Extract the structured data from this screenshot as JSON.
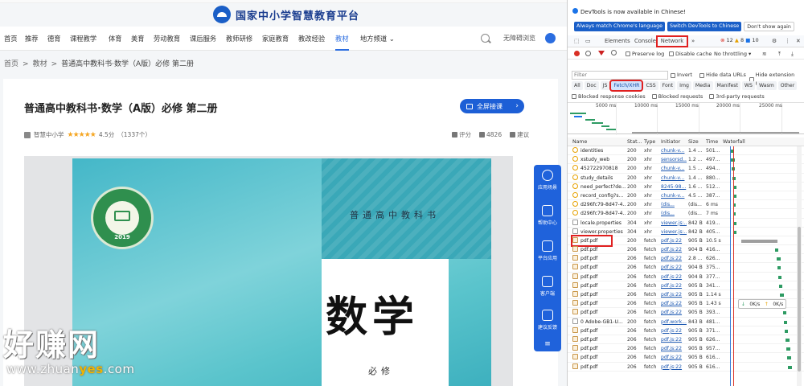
{
  "site": {
    "title": "国家中小学智慧教育平台"
  },
  "nav": {
    "items": [
      "首页",
      "推荐",
      "德育",
      "课程教学",
      "体育",
      "美育",
      "劳动教育",
      "课后服务",
      "教师研修",
      "家庭教育",
      "教改经验",
      "教材",
      "地方频道"
    ],
    "active": "教材",
    "accessibility": "无障碍浏览",
    "dropdown_glyph": "⌄"
  },
  "breadcrumb": {
    "items": [
      "首页",
      "教材",
      "普通高中教科书·数学（A版）必修 第二册"
    ],
    "sep": ">"
  },
  "book": {
    "title": "普通高中教科书·数学（A版）必修 第二册",
    "download_label": "全屏接课",
    "publisher": "智慧中小学",
    "stars": "★★★★★",
    "rating": "4.5分",
    "rating_count": "（1337个）",
    "actions": {
      "rate": "评分",
      "likes": "4826",
      "suggest": "建议"
    },
    "cover": {
      "series": "普通高中教科书",
      "subject": "数学",
      "volume": "必修",
      "seal_year": "2019"
    }
  },
  "side_panel": {
    "items": [
      "应用场景",
      "帮助中心",
      "平台应用",
      "客户端",
      "建议反馈"
    ]
  },
  "watermark": {
    "main": "好赚网",
    "url_a": "www.zhuan",
    "url_b": "yes",
    "url_c": ".com"
  },
  "devtools": {
    "notice": "DevTools is now available in Chinese!",
    "btn_match": "Always match Chrome's language",
    "btn_switch": "Switch DevTools to Chinese",
    "btn_dismiss": "Don't show again",
    "tabs": [
      "Elements",
      "Console",
      "Network"
    ],
    "active_tab": "Network",
    "more": "»",
    "errors": "12",
    "warnings": "8",
    "infos": "10",
    "toolbar": {
      "preserve_log": "Preserve log",
      "disable_cache": "Disable cache",
      "throttling": "No throttling",
      "download": "⤓"
    },
    "filter_placeholder": "Filter",
    "invert": "Invert",
    "hide_data_urls": "Hide data URLs",
    "hide_ext_urls": "Hide extension URLs",
    "types": [
      "All",
      "Doc",
      "JS",
      "Fetch/XHR",
      "CSS",
      "Font",
      "Img",
      "Media",
      "Manifest",
      "WS",
      "Wasm",
      "Other"
    ],
    "selected_type": "Fetch/XHR",
    "blocked_cookies": "Blocked response cookies",
    "blocked_requests": "Blocked requests",
    "third_party": "3rd-party requests",
    "overview_ticks": [
      "5000 ms",
      "10000 ms",
      "15000 ms",
      "20000 ms",
      "25000 ms"
    ],
    "columns": [
      "Name",
      "Stat...",
      "Type",
      "Initiator",
      "Size",
      "Time",
      "Waterfall"
    ],
    "rows": [
      {
        "name": "identities",
        "status": "200",
        "type": "xhr",
        "initiator": "chunk-v...",
        "size": "1.4 ...",
        "time": "501...",
        "kind": "xhr"
      },
      {
        "name": "xstudy_web",
        "status": "200",
        "type": "xhr",
        "initiator": "sensorsd...",
        "size": "1.2 ...",
        "time": "497...",
        "kind": "xhr"
      },
      {
        "name": "452722970818",
        "status": "200",
        "type": "xhr",
        "initiator": "chunk-v...",
        "size": "1.5 ...",
        "time": "494...",
        "kind": "xhr"
      },
      {
        "name": "study_details",
        "status": "200",
        "type": "xhr",
        "initiator": "chunk-v...",
        "size": "1.4 ...",
        "time": "880...",
        "kind": "xhr"
      },
      {
        "name": "need_perfect?de...",
        "status": "200",
        "type": "xhr",
        "initiator": "8245-98...",
        "size": "1.6 ...",
        "time": "512...",
        "kind": "xhr"
      },
      {
        "name": "record_config?s...",
        "status": "200",
        "type": "xhr",
        "initiator": "chunk-v...",
        "size": "4.5 ...",
        "time": "387...",
        "kind": "xhr"
      },
      {
        "name": "d296fc79-8d47-4...",
        "status": "200",
        "type": "xhr",
        "initiator": "(dis...",
        "size": "(dis...",
        "time": "6 ms",
        "kind": "xhr"
      },
      {
        "name": "d296fc79-8d47-4...",
        "status": "200",
        "type": "xhr",
        "initiator": "(dis...",
        "size": "(dis...",
        "time": "7 ms",
        "kind": "xhr"
      },
      {
        "name": "locale.properties",
        "status": "304",
        "type": "xhr",
        "initiator": "viewer.js:...",
        "size": "842 B",
        "time": "419...",
        "kind": "doc"
      },
      {
        "name": "viewer.properties",
        "status": "304",
        "type": "xhr",
        "initiator": "viewer.js:...",
        "size": "842 B",
        "time": "405...",
        "kind": "doc"
      },
      {
        "name": "pdf.pdf",
        "status": "200",
        "type": "fetch",
        "initiator": "pdf.js:22",
        "size": "905 B",
        "time": "10.5 s",
        "kind": "pdf",
        "boxed": true
      },
      {
        "name": "pdf.pdf",
        "status": "206",
        "type": "fetch",
        "initiator": "pdf.js:22",
        "size": "904 B",
        "time": "416...",
        "kind": "pdf"
      },
      {
        "name": "pdf.pdf",
        "status": "206",
        "type": "fetch",
        "initiator": "pdf.js:22",
        "size": "2.8 ...",
        "time": "626...",
        "kind": "pdf"
      },
      {
        "name": "pdf.pdf",
        "status": "206",
        "type": "fetch",
        "initiator": "pdf.js:22",
        "size": "904 B",
        "time": "375...",
        "kind": "pdf"
      },
      {
        "name": "pdf.pdf",
        "status": "206",
        "type": "fetch",
        "initiator": "pdf.js:22",
        "size": "904 B",
        "time": "377...",
        "kind": "pdf"
      },
      {
        "name": "pdf.pdf",
        "status": "206",
        "type": "fetch",
        "initiator": "pdf.js:22",
        "size": "905 B",
        "time": "341...",
        "kind": "pdf"
      },
      {
        "name": "pdf.pdf",
        "status": "206",
        "type": "fetch",
        "initiator": "pdf.js:22",
        "size": "905 B",
        "time": "1.14 s",
        "kind": "pdf"
      },
      {
        "name": "pdf.pdf",
        "status": "206",
        "type": "fetch",
        "initiator": "pdf.js:22",
        "size": "905 B",
        "time": "1.43 s",
        "kind": "pdf"
      },
      {
        "name": "pdf.pdf",
        "status": "206",
        "type": "fetch",
        "initiator": "pdf.js:22",
        "size": "905 B",
        "time": "393...",
        "kind": "pdf"
      },
      {
        "name": "0 Adobe-GB1-U...",
        "status": "200",
        "type": "fetch",
        "initiator": "pdf.work...",
        "size": "843 B",
        "time": "481...",
        "kind": "doc"
      },
      {
        "name": "pdf.pdf",
        "status": "206",
        "type": "fetch",
        "initiator": "pdf.js:22",
        "size": "905 B",
        "time": "371...",
        "kind": "pdf"
      },
      {
        "name": "pdf.pdf",
        "status": "206",
        "type": "fetch",
        "initiator": "pdf.js:22",
        "size": "905 B",
        "time": "626...",
        "kind": "pdf"
      },
      {
        "name": "pdf.pdf",
        "status": "206",
        "type": "fetch",
        "initiator": "pdf.js:22",
        "size": "905 B",
        "time": "957...",
        "kind": "pdf"
      },
      {
        "name": "pdf.pdf",
        "status": "206",
        "type": "fetch",
        "initiator": "pdf.js:22",
        "size": "905 B",
        "time": "616...",
        "kind": "pdf"
      },
      {
        "name": "pdf.pdf",
        "status": "206",
        "type": "fetch",
        "initiator": "pdf.js:22",
        "size": "905 B",
        "time": "616...",
        "kind": "pdf"
      }
    ],
    "tooltip": {
      "down": "0K/s",
      "up": "0K/s"
    }
  }
}
